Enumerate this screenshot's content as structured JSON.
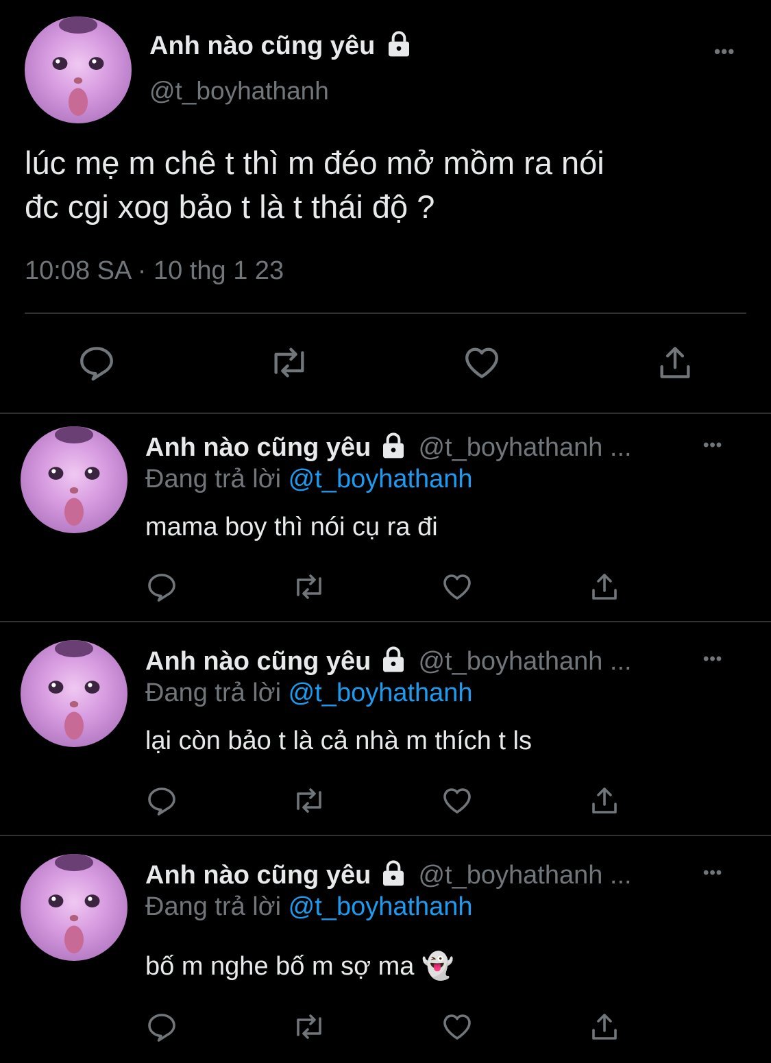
{
  "main_tweet": {
    "display_name": "Anh nào cũng yêu",
    "handle": "@t_boyhathanh",
    "text_line1": "lúc mẹ m chê t thì m đéo mở mồm ra nói",
    "text_line2": "đc cgi xog bảo t là t thái độ ?",
    "timestamp": "10:08 SA · 10 thg 1 23",
    "more_label": "•••"
  },
  "replies": [
    {
      "display_name": "Anh nào cũng yêu",
      "handle": "@t_boyhathanh ...",
      "replying_prefix": "Đang trả lời",
      "replying_to": "@t_boyhathanh",
      "text": "mama boy thì nói cụ ra đi",
      "more_label": "•••"
    },
    {
      "display_name": "Anh nào cũng yêu",
      "handle": "@t_boyhathanh ...",
      "replying_prefix": "Đang trả lời",
      "replying_to": "@t_boyhathanh",
      "text": "lại còn bảo t là cả nhà m thích t ls",
      "more_label": "•••"
    },
    {
      "display_name": "Anh nào cũng yêu",
      "handle": "@t_boyhathanh ...",
      "replying_prefix": "Đang trả lời",
      "replying_to": "@t_boyhathanh",
      "text": "bố m nghe bố m sợ ma 👻",
      "more_label": "•••"
    }
  ],
  "icons": {
    "reply": "reply-icon",
    "retweet": "retweet-icon",
    "like": "heart-icon",
    "share": "share-icon",
    "lock": "lock-icon",
    "more": "more-icon"
  },
  "colors": {
    "background": "#000000",
    "text": "#e7e9ea",
    "secondary": "#71767b",
    "link": "#1d9bf0",
    "divider": "#2f3336"
  }
}
